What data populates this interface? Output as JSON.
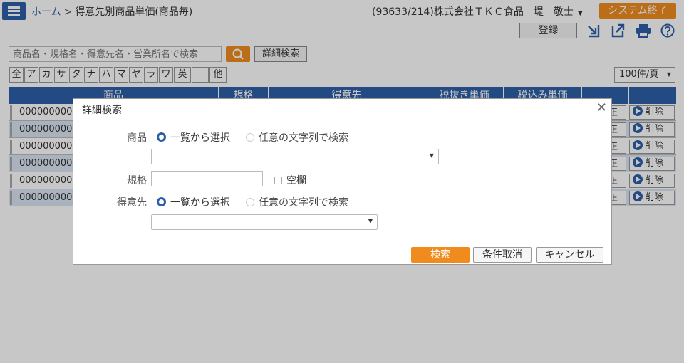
{
  "header": {
    "home": "ホーム",
    "separator": ">",
    "page_title": "得意先別商品単価(商品毎)",
    "user": "(93633/214)株式会社ＴＫＣ食品　堤　敬士",
    "exit_label": "システム終了"
  },
  "toolbar": {
    "register_label": "登録"
  },
  "search": {
    "placeholder": "商品名・規格名・得意先名・営業所名で検索",
    "detail_label": "詳細検索",
    "per_page": "100件/頁"
  },
  "kana": [
    "全",
    "ア",
    "カ",
    "サ",
    "タ",
    "ナ",
    "ハ",
    "マ",
    "ヤ",
    "ラ",
    "ワ",
    "英",
    "",
    "他"
  ],
  "table": {
    "columns": [
      "商品",
      "規格",
      "得意先",
      "税抜き単価",
      "税込み単価",
      "",
      ""
    ],
    "rows": [
      {
        "code": "00000000000",
        "edit": "正",
        "delete": "削除"
      },
      {
        "code": "00000000000",
        "edit": "正",
        "delete": "削除"
      },
      {
        "code": "00000000000",
        "edit": "正",
        "delete": "削除"
      },
      {
        "code": "00000000000",
        "edit": "正",
        "delete": "削除"
      },
      {
        "code": "00000000000",
        "edit": "正",
        "delete": "削除"
      },
      {
        "code": "00000000000",
        "edit": "正",
        "delete": "削除"
      }
    ]
  },
  "modal": {
    "title": "詳細検索",
    "product_label": "商品",
    "spec_label": "規格",
    "customer_label": "得意先",
    "radio_list": "一覧から選択",
    "radio_text": "任意の文字列で検索",
    "blank_label": "空欄",
    "search_label": "検索",
    "clear_label": "条件取消",
    "cancel_label": "キャンセル"
  },
  "colors": {
    "primary": "#2d5fa8",
    "accent": "#f08c1e"
  }
}
